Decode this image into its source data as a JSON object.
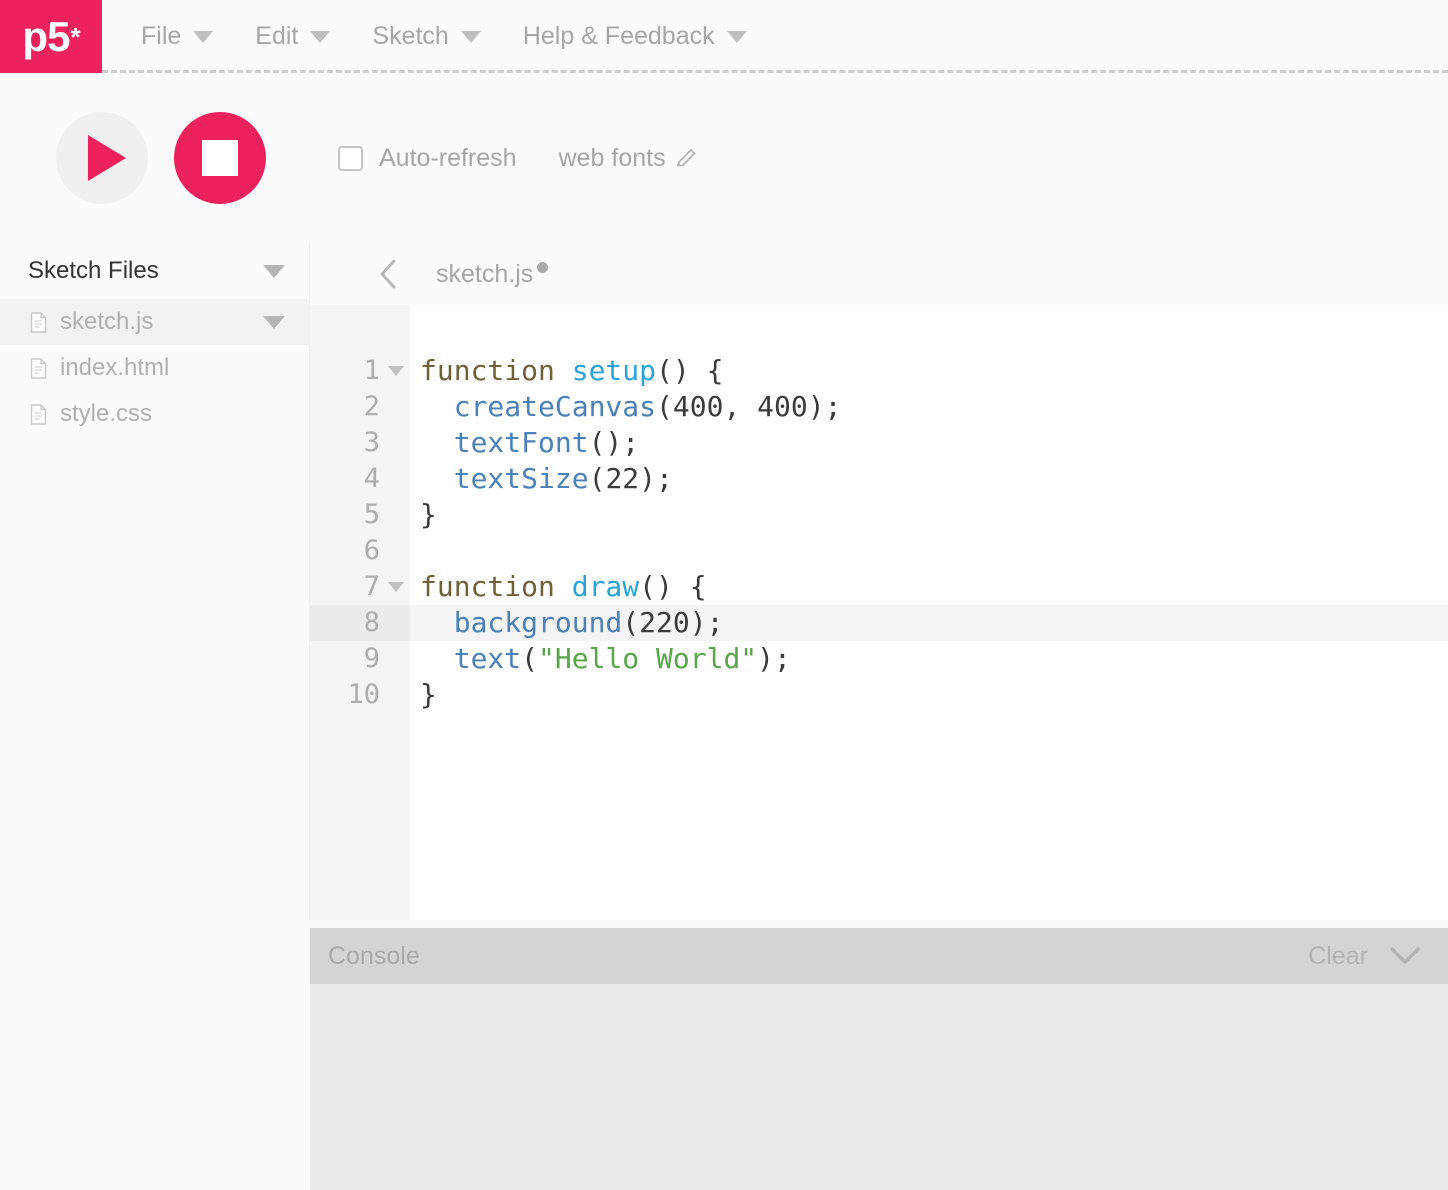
{
  "brand": {
    "logo_text": "p5",
    "logo_star": "*",
    "accent_color": "#ed225d"
  },
  "nav": {
    "menu_items": [
      {
        "label": "File",
        "icon": "chevron-down-icon"
      },
      {
        "label": "Edit",
        "icon": "chevron-down-icon"
      },
      {
        "label": "Sketch",
        "icon": "chevron-down-icon"
      },
      {
        "label": "Help & Feedback",
        "icon": "chevron-down-icon"
      }
    ]
  },
  "toolbar": {
    "play_icon": "play-icon",
    "stop_icon": "stop-icon",
    "auto_refresh_label": "Auto-refresh",
    "auto_refresh_checked": false,
    "web_fonts_label": "web fonts",
    "web_fonts_icon": "pencil-icon"
  },
  "sidebar": {
    "title": "Sketch Files",
    "collapse_icon": "caret-down-icon",
    "files": [
      {
        "name": "sketch.js",
        "icon": "file-icon",
        "selected": true,
        "has_menu": true
      },
      {
        "name": "index.html",
        "icon": "file-icon",
        "selected": false,
        "has_menu": false
      },
      {
        "name": "style.css",
        "icon": "file-icon",
        "selected": false,
        "has_menu": false
      }
    ]
  },
  "tabbar": {
    "back_icon": "chevron-left-icon",
    "active_tab": "sketch.js",
    "unsaved": true
  },
  "editor": {
    "active_line": 8,
    "lines": [
      {
        "n": "1",
        "fold": true,
        "tokens": [
          {
            "t": "function ",
            "c": "tk-kw"
          },
          {
            "t": "setup",
            "c": "tk-def"
          },
          {
            "t": "() {",
            "c": "tk-pl"
          }
        ]
      },
      {
        "n": "2",
        "fold": false,
        "tokens": [
          {
            "t": "  ",
            "c": "tk-pl"
          },
          {
            "t": "createCanvas",
            "c": "tk-fn"
          },
          {
            "t": "(",
            "c": "tk-pl"
          },
          {
            "t": "400",
            "c": "tk-num"
          },
          {
            "t": ", ",
            "c": "tk-pl"
          },
          {
            "t": "400",
            "c": "tk-num"
          },
          {
            "t": ");",
            "c": "tk-pl"
          }
        ]
      },
      {
        "n": "3",
        "fold": false,
        "tokens": [
          {
            "t": "  ",
            "c": "tk-pl"
          },
          {
            "t": "textFont",
            "c": "tk-fn"
          },
          {
            "t": "();",
            "c": "tk-pl"
          }
        ]
      },
      {
        "n": "4",
        "fold": false,
        "tokens": [
          {
            "t": "  ",
            "c": "tk-pl"
          },
          {
            "t": "textSize",
            "c": "tk-fn"
          },
          {
            "t": "(",
            "c": "tk-pl"
          },
          {
            "t": "22",
            "c": "tk-num"
          },
          {
            "t": ");",
            "c": "tk-pl"
          }
        ]
      },
      {
        "n": "5",
        "fold": false,
        "tokens": [
          {
            "t": "}",
            "c": "tk-pl"
          }
        ]
      },
      {
        "n": "6",
        "fold": false,
        "tokens": [
          {
            "t": "",
            "c": "tk-pl"
          }
        ]
      },
      {
        "n": "7",
        "fold": true,
        "tokens": [
          {
            "t": "function ",
            "c": "tk-kw"
          },
          {
            "t": "draw",
            "c": "tk-def"
          },
          {
            "t": "() {",
            "c": "tk-pl"
          }
        ]
      },
      {
        "n": "8",
        "fold": false,
        "tokens": [
          {
            "t": "  ",
            "c": "tk-pl"
          },
          {
            "t": "background",
            "c": "tk-fn"
          },
          {
            "t": "(",
            "c": "tk-pl"
          },
          {
            "t": "220",
            "c": "tk-num"
          },
          {
            "t": ");",
            "c": "tk-pl"
          }
        ]
      },
      {
        "n": "9",
        "fold": false,
        "tokens": [
          {
            "t": "  ",
            "c": "tk-pl"
          },
          {
            "t": "text",
            "c": "tk-fn"
          },
          {
            "t": "(",
            "c": "tk-pl"
          },
          {
            "t": "\"Hello World\"",
            "c": "tk-str"
          },
          {
            "t": ");",
            "c": "tk-pl"
          }
        ]
      },
      {
        "n": "10",
        "fold": false,
        "tokens": [
          {
            "t": "}",
            "c": "tk-pl"
          }
        ]
      }
    ]
  },
  "console": {
    "title": "Console",
    "clear_label": "Clear",
    "collapse_icon": "chevron-down-icon",
    "messages": []
  }
}
